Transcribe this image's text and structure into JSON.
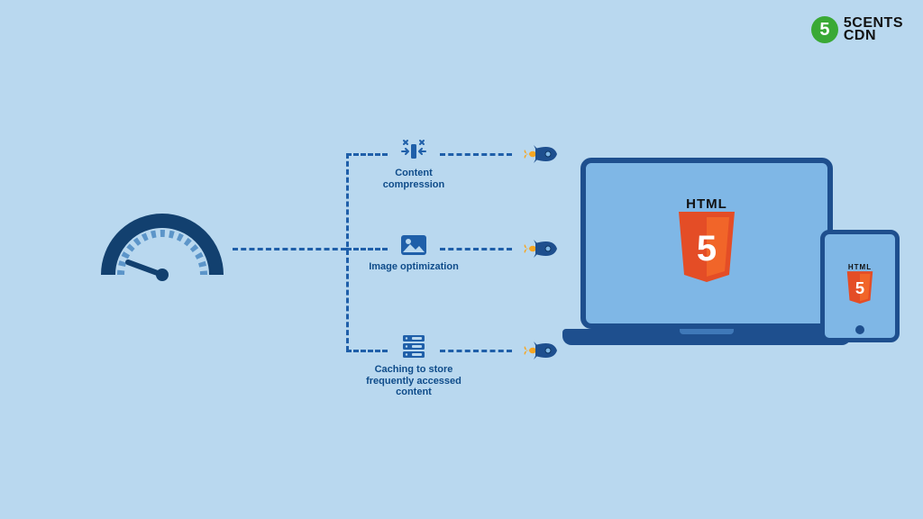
{
  "logo": {
    "badge": "5",
    "line1": "5CENTS",
    "line2": "CDN"
  },
  "features": [
    {
      "label": "Content compression",
      "icon": "compress-icon"
    },
    {
      "label": "Image optimization",
      "icon": "image-icon"
    },
    {
      "label": "Caching to store frequently accessed content",
      "icon": "server-icon"
    }
  ],
  "device_badge": {
    "title": "HTML",
    "number": "5"
  },
  "colors": {
    "bg": "#b9d8ef",
    "primary": "#1f5fa9",
    "dark": "#1e4f8e",
    "accent_orange": "#e44d26",
    "accent_green": "#3aa935",
    "flame": "#f6a623"
  }
}
